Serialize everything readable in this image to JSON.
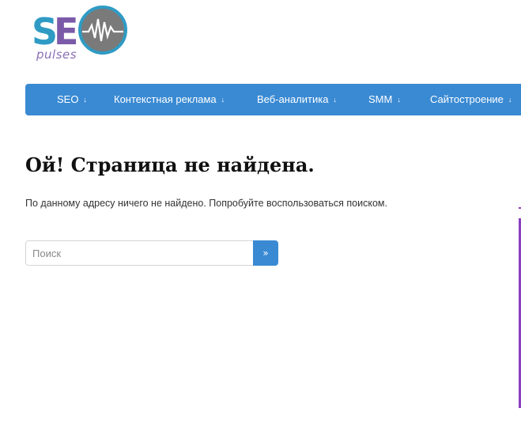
{
  "brand": {
    "logo_letters": "SE",
    "logo_word": "pulses",
    "colors": {
      "purple": "#7b5aa8",
      "teal": "#2f9bc4",
      "gray": "#7a7a7a"
    }
  },
  "nav": {
    "color": "#3a8ad3",
    "items": [
      {
        "label": "SEO"
      },
      {
        "label": "Контекстная реклама"
      },
      {
        "label": "Веб-аналитика"
      },
      {
        "label": "SMM"
      },
      {
        "label": "Сайтостроение"
      }
    ]
  },
  "main": {
    "title": "Ой! Страница не найдена.",
    "description": "По данному адресу ничего не найдено. Попробуйте воспользоваться поиском."
  },
  "search": {
    "placeholder": "Поиск",
    "value": "",
    "button_label": "»"
  }
}
